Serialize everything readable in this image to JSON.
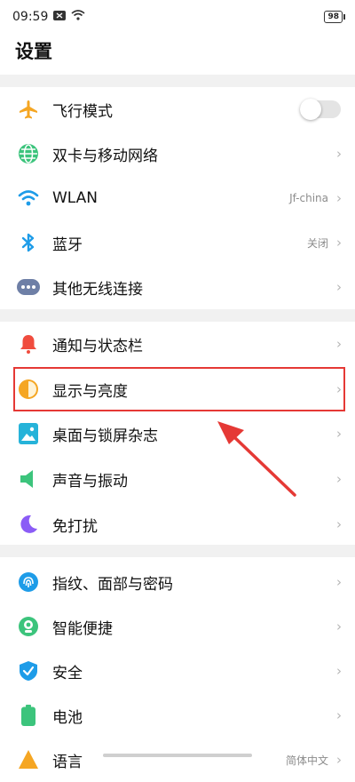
{
  "status_bar": {
    "time": "09:59",
    "battery": "98"
  },
  "header": {
    "title": "设置"
  },
  "sections": [
    [
      {
        "key": "airplane",
        "label": "飞行模式",
        "type": "toggle",
        "on": false
      },
      {
        "key": "dualsim",
        "label": "双卡与移动网络",
        "type": "chevron"
      },
      {
        "key": "wlan",
        "label": "WLAN",
        "value": "Jf-china",
        "type": "chevron"
      },
      {
        "key": "bluetooth",
        "label": "蓝牙",
        "value": "关闭",
        "type": "chevron"
      },
      {
        "key": "wireless-other",
        "label": "其他无线连接",
        "type": "chevron"
      }
    ],
    [
      {
        "key": "notification",
        "label": "通知与状态栏",
        "type": "chevron"
      },
      {
        "key": "display",
        "label": "显示与亮度",
        "type": "chevron",
        "highlighted": true
      },
      {
        "key": "desktop",
        "label": "桌面与锁屏杂志",
        "type": "chevron"
      },
      {
        "key": "sound",
        "label": "声音与振动",
        "type": "chevron"
      },
      {
        "key": "dnd",
        "label": "免打扰",
        "type": "chevron"
      }
    ],
    [
      {
        "key": "fingerprint",
        "label": "指纹、面部与密码",
        "type": "chevron"
      },
      {
        "key": "smart",
        "label": "智能便捷",
        "type": "chevron"
      },
      {
        "key": "security",
        "label": "安全",
        "type": "chevron"
      },
      {
        "key": "battery",
        "label": "电池",
        "type": "chevron"
      },
      {
        "key": "language",
        "label": "语言",
        "value": "简体中文",
        "type": "chevron",
        "partial": true
      }
    ]
  ],
  "chevron_glyph": "›",
  "colors": {
    "highlight": "#e53935",
    "arrow": "#e53935",
    "separator": "#f1f1f1"
  }
}
